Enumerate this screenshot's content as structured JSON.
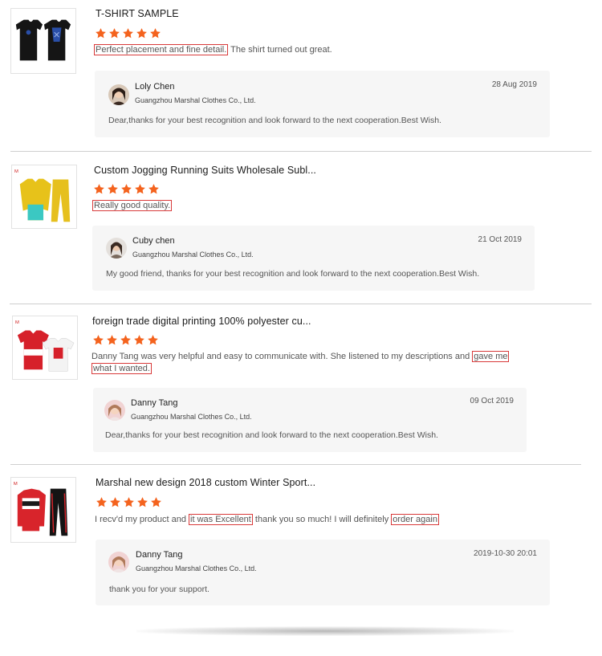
{
  "reviews": [
    {
      "title": "T-SHIRT SAMPLE",
      "rating": 5,
      "text_parts": [
        {
          "t": "Perfect placement and fine detail.",
          "hl": true
        },
        {
          "t": " The shirt turned out great.",
          "hl": false
        }
      ],
      "reply": {
        "name": "Loly Chen",
        "company": "Guangzhou Marshal Clothes Co., Ltd.",
        "date": "28 Aug 2019",
        "text": "Dear,thanks for your best recognition and look forward to the next cooperation.Best Wish."
      }
    },
    {
      "title": "Custom Jogging Running Suits Wholesale Subl...",
      "rating": 5,
      "text_parts": [
        {
          "t": "Really good quality.",
          "hl": true
        }
      ],
      "reply": {
        "name": "Cuby chen",
        "company": "Guangzhou Marshal Clothes Co., Ltd.",
        "date": "21 Oct 2019",
        "text": "My good friend, thanks for your best recognition and look forward to the next cooperation.Best Wish."
      }
    },
    {
      "title": "foreign trade digital printing 100% polyester cu...",
      "rating": 5,
      "text_line1": "Danny Tang was very helpful and easy to communicate with. She listened to my descriptions and ",
      "text_line1_hl": "gave me",
      "text_line2_hl": "what I wanted.",
      "reply": {
        "name": "Danny Tang",
        "company": "Guangzhou Marshal Clothes Co., Ltd.",
        "date": "09 Oct 2019",
        "text": "Dear,thanks for your best recognition and look forward to the next cooperation.Best Wish."
      }
    },
    {
      "title": "Marshal new design 2018 custom Winter Sport...",
      "rating": 5,
      "text_parts": [
        {
          "t": "I recv'd my product and ",
          "hl": false
        },
        {
          "t": "it was Excellent",
          "hl": true
        },
        {
          "t": " thank you so much! I will definitely ",
          "hl": false
        },
        {
          "t": "order again",
          "hl": true
        }
      ],
      "reply": {
        "name": "Danny Tang",
        "company": "Guangzhou Marshal Clothes Co., Ltd.",
        "date": "2019-10-30 20:01",
        "text": "thank you for your support."
      }
    }
  ],
  "colors": {
    "star": "#f4631e",
    "highlight_border": "#d83a3a",
    "reply_bg": "#f6f6f6"
  }
}
